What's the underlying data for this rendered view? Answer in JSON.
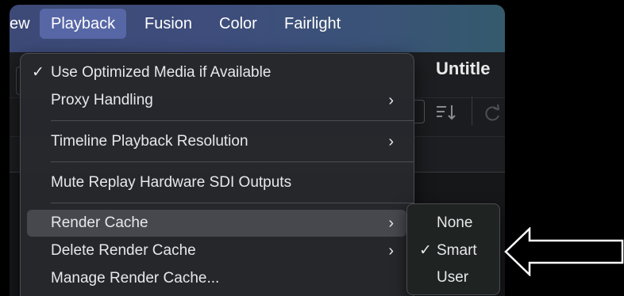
{
  "menubar": {
    "items": [
      {
        "label": "ew"
      },
      {
        "label": "Playback",
        "active": true
      },
      {
        "label": "Fusion"
      },
      {
        "label": "Color"
      },
      {
        "label": "Fairlight"
      }
    ]
  },
  "window": {
    "title_fragment": "Untitle"
  },
  "colors": {
    "menubar_gradient_start": "#3d4a78",
    "menubar_active": "#5767a6",
    "menu_background": "#26282c",
    "menu_highlight": "#46484e",
    "submenu_background": "#1f2322",
    "text": "#e8e8ea",
    "arrow": "#ffffff"
  },
  "playback_menu": {
    "items": [
      {
        "label": "Use Optimized Media if Available",
        "check": "✓",
        "submenu": false
      },
      {
        "label": "Proxy Handling",
        "check": "",
        "submenu": true,
        "chevron": "›"
      },
      {
        "label": "Timeline Playback Resolution",
        "check": "",
        "submenu": true,
        "chevron": "›"
      },
      {
        "label": "Mute Replay Hardware SDI Outputs",
        "check": "",
        "submenu": false
      },
      {
        "label": "Render Cache",
        "check": "",
        "submenu": true,
        "chevron": "›",
        "highlighted": true
      },
      {
        "label": "Delete Render Cache",
        "check": "",
        "submenu": true,
        "chevron": "›"
      },
      {
        "label": "Manage Render Cache...",
        "check": "",
        "submenu": false
      }
    ]
  },
  "render_cache_submenu": {
    "items": [
      {
        "label": "None",
        "check": ""
      },
      {
        "label": "Smart",
        "check": "✓"
      },
      {
        "label": "User",
        "check": ""
      }
    ]
  },
  "icons": {
    "sort": "sort-lines-icon",
    "refresh": "refresh-icon",
    "annotation": "left-arrow-icon"
  }
}
